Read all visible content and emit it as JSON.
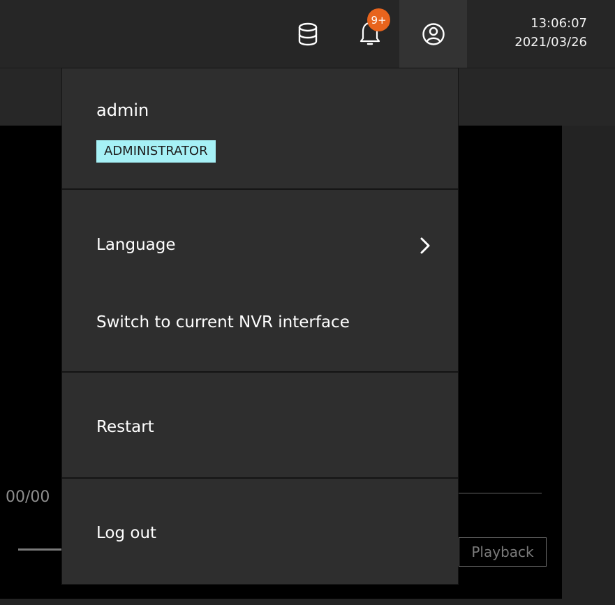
{
  "header": {
    "notification_badge": "9+",
    "time": "13:06:07",
    "date": "2021/03/26",
    "icons": [
      "database-icon",
      "bell-icon",
      "user-icon"
    ],
    "badge_color": "#e8641d"
  },
  "background": {
    "time_fragment": "00/00",
    "playback_label": "Playback"
  },
  "user_menu": {
    "username": "admin",
    "role": "ADMINISTRATOR",
    "role_color": "#a6f1f6",
    "items": {
      "language": "Language",
      "switch_nvr": "Switch to current NVR interface",
      "restart": "Restart",
      "logout": "Log out"
    }
  }
}
